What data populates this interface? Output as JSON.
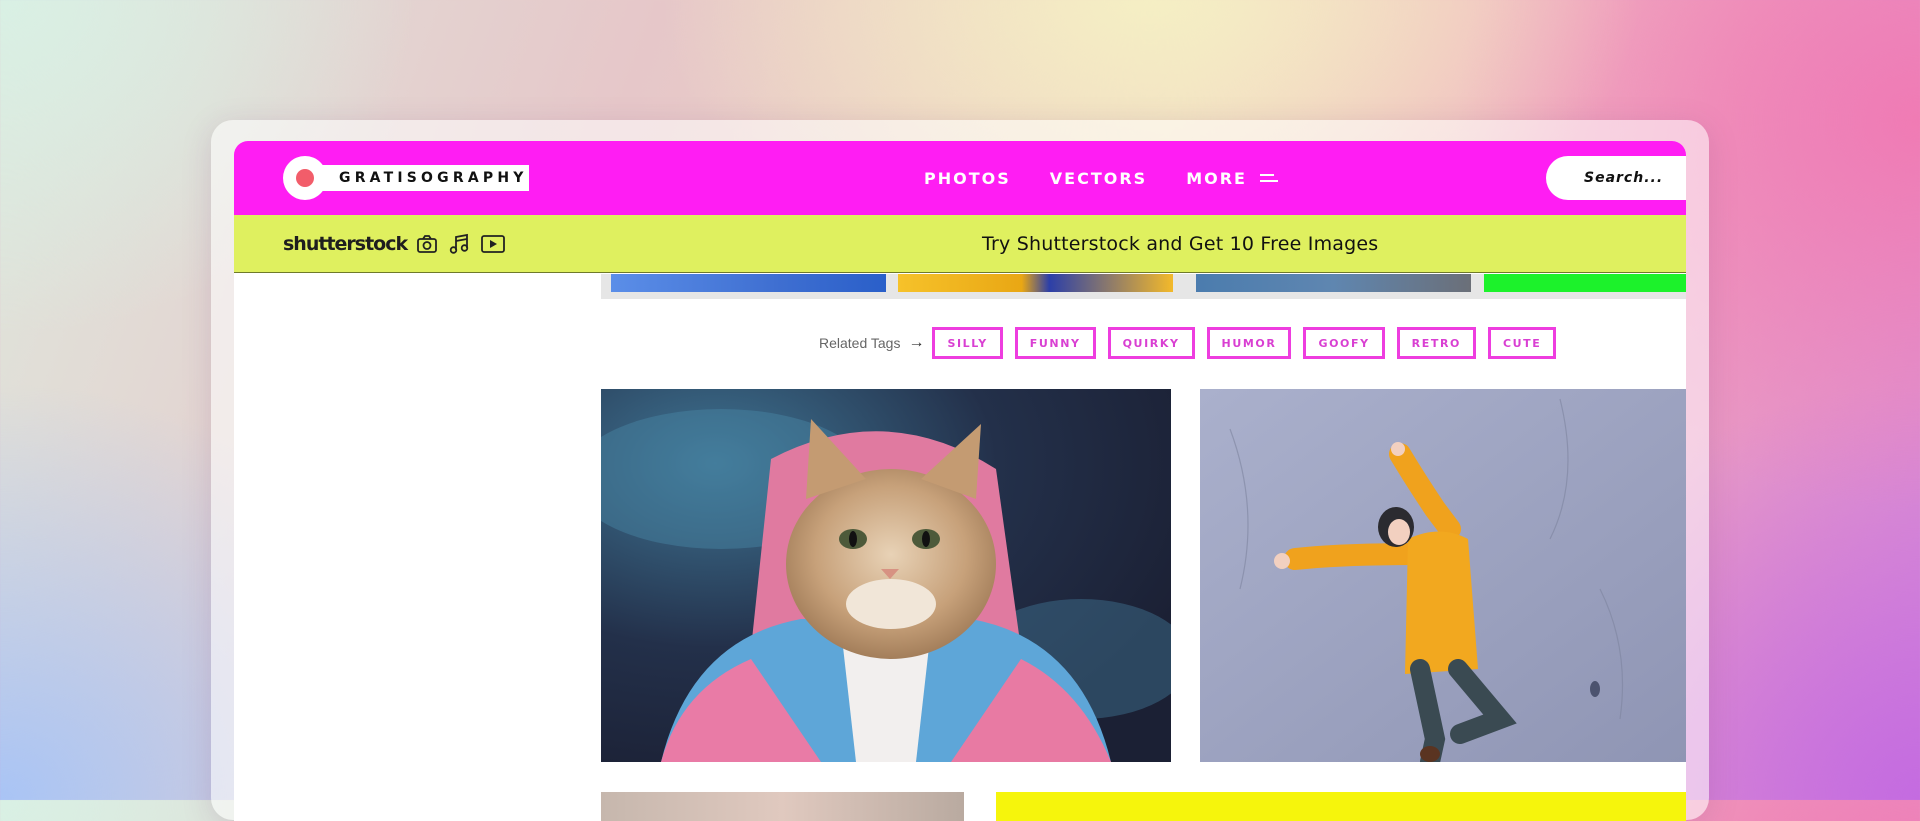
{
  "header": {
    "logo_text": "GRATISOGRAPHY",
    "nav": [
      "PHOTOS",
      "VECTORS",
      "MORE"
    ],
    "search_placeholder": "Search..."
  },
  "promo": {
    "brand": "shutterstock",
    "text": "Try Shutterstock and Get 10 Free Images",
    "icons": [
      "camera-icon",
      "music-note-icon",
      "video-play-icon"
    ]
  },
  "related": {
    "label": "Related Tags",
    "tags": [
      "SILLY",
      "FUNNY",
      "QUIRKY",
      "HUMOR",
      "GOOFY",
      "RETRO",
      "CUTE"
    ]
  },
  "colors": {
    "header_bg": "#ff1df3",
    "promo_bg": "#dff05f",
    "tag_border": "#ee3ddf"
  }
}
